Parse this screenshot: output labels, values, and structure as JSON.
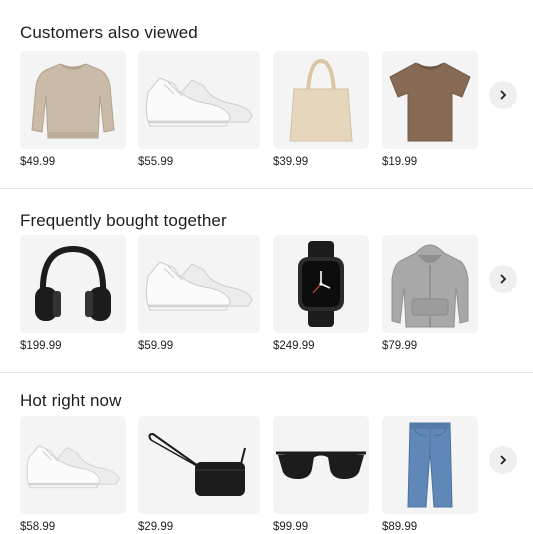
{
  "sections": [
    {
      "title": "Customers also viewed",
      "products": [
        {
          "name": "sweater",
          "icon": "sweater-icon",
          "price": "$49.99"
        },
        {
          "name": "sneakers",
          "icon": "sneaker-icon",
          "price": "$55.99"
        },
        {
          "name": "tote bag",
          "icon": "tote-bag-icon",
          "price": "$39.99"
        },
        {
          "name": "t-shirt",
          "icon": "tshirt-icon",
          "price": "$19.99"
        }
      ]
    },
    {
      "title": "Frequently bought together",
      "products": [
        {
          "name": "headphones",
          "icon": "headphones-icon",
          "price": "$199.99"
        },
        {
          "name": "sneakers",
          "icon": "sneaker-icon",
          "price": "$59.99"
        },
        {
          "name": "smartwatch",
          "icon": "smartwatch-icon",
          "price": "$249.99"
        },
        {
          "name": "hoodie",
          "icon": "hoodie-icon",
          "price": "$79.99"
        }
      ]
    },
    {
      "title": "Hot right now",
      "products": [
        {
          "name": "sneakers",
          "icon": "sneaker-icon",
          "price": "$58.99"
        },
        {
          "name": "crossbody bag",
          "icon": "crossbody-bag-icon",
          "price": "$29.99"
        },
        {
          "name": "sunglasses",
          "icon": "sunglasses-icon",
          "price": "$99.99"
        },
        {
          "name": "jeans",
          "icon": "jeans-icon",
          "price": "$89.99"
        }
      ]
    }
  ],
  "next_icon": "chevron-right-icon",
  "colors": {
    "tile_bg": "#f4f4f4",
    "divider": "#e7e7e7",
    "sweater": "#c9bba8",
    "tshirt": "#866a54",
    "tote": "#e5d6bc",
    "hoodie": "#a8a8a8",
    "jeans": "#5f87b7",
    "black": "#1c1c1c",
    "sneaker": "#fbfbfb"
  }
}
